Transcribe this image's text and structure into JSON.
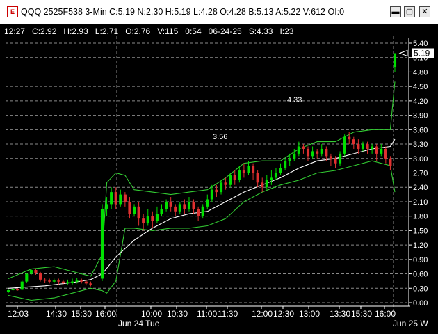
{
  "window": {
    "title": "QQQ 2525F538 3-Min C:5.19 N:2.30 H:5.19 L:4.28 O:4.28 B:5.13 A:5.22 V:612 OI:0",
    "app_icon": "E",
    "min_label": "▬",
    "max_label": "▢",
    "close_label": "✕"
  },
  "infobar": {
    "time": "12:27",
    "close": "C:2.92",
    "high": "H:2.93",
    "low": "L:2.71",
    "open": "O:2.76",
    "volume": "V:115",
    "elapsed": "0:54",
    "date": "06-24-25",
    "s": "S:4.33",
    "i": "I:23"
  },
  "chart_data": {
    "type": "candlestick",
    "y_axis_ticks": [
      "5.40",
      "5.10",
      "4.80",
      "4.50",
      "4.20",
      "3.90",
      "3.60",
      "3.30",
      "3.00",
      "2.70",
      "2.40",
      "2.10",
      "1.80",
      "1.50",
      "1.20",
      "0.90",
      "0.60",
      "0.30",
      "0.00"
    ],
    "ylim": [
      0,
      5.4
    ],
    "x_axis_ticks": [
      "12:03",
      "14:30",
      "15:30",
      "16:00",
      "10:00",
      "10:30",
      "11:00",
      "11:30",
      "12:00",
      "12:30",
      "13:00",
      "13:30",
      "15:30",
      "16:00"
    ],
    "x_date_labels": [
      "Jun 24 Tue",
      "Jun 25 W"
    ],
    "last_price": "5.19",
    "annotations": [
      "3.56",
      "4.33"
    ],
    "colors": {
      "up": "#00e000",
      "down": "#e03030",
      "band": "#33cc33",
      "ma": "#ffffff",
      "grid": "#8a8a8a"
    },
    "candles": [
      [
        0.22,
        0.26,
        0.2,
        0.28
      ],
      [
        0.26,
        0.29,
        0.24,
        0.31
      ],
      [
        0.28,
        0.27,
        0.25,
        0.3
      ],
      [
        0.27,
        0.44,
        0.26,
        0.46
      ],
      [
        0.44,
        0.6,
        0.42,
        0.62
      ],
      [
        0.6,
        0.68,
        0.58,
        0.7
      ],
      [
        0.68,
        0.62,
        0.58,
        0.7
      ],
      [
        0.62,
        0.48,
        0.44,
        0.64
      ],
      [
        0.48,
        0.46,
        0.42,
        0.52
      ],
      [
        0.46,
        0.44,
        0.4,
        0.5
      ],
      [
        0.44,
        0.46,
        0.4,
        0.5
      ],
      [
        0.46,
        0.44,
        0.38,
        0.5
      ],
      [
        0.44,
        0.42,
        0.38,
        0.48
      ],
      [
        0.42,
        0.43,
        0.38,
        0.48
      ],
      [
        0.43,
        0.44,
        0.38,
        0.5
      ],
      [
        0.44,
        0.46,
        0.4,
        0.52
      ],
      [
        0.46,
        0.44,
        0.4,
        0.5
      ],
      [
        0.44,
        0.4,
        0.36,
        0.48
      ],
      [
        0.4,
        0.38,
        0.34,
        0.44
      ],
      [
        0.5,
        1.95,
        0.45,
        2.05
      ],
      [
        1.95,
        2.05,
        1.8,
        2.2
      ],
      [
        2.05,
        2.3,
        1.95,
        2.4
      ],
      [
        2.3,
        2.05,
        1.95,
        2.4
      ],
      [
        2.05,
        2.25,
        2.0,
        2.35
      ],
      [
        2.25,
        2.1,
        2.0,
        2.3
      ],
      [
        2.1,
        1.85,
        1.75,
        2.2
      ],
      [
        1.85,
        2.0,
        1.8,
        2.05
      ],
      [
        2.0,
        1.75,
        1.6,
        2.1
      ],
      [
        1.75,
        1.65,
        1.5,
        1.85
      ],
      [
        1.65,
        1.8,
        1.6,
        1.95
      ],
      [
        1.8,
        1.7,
        1.55,
        1.9
      ],
      [
        1.7,
        1.85,
        1.65,
        2.0
      ],
      [
        1.85,
        1.95,
        1.8,
        2.05
      ],
      [
        1.95,
        2.1,
        1.9,
        2.15
      ],
      [
        2.1,
        2.0,
        1.9,
        2.2
      ],
      [
        2.0,
        1.9,
        1.8,
        2.05
      ],
      [
        1.9,
        2.05,
        1.85,
        2.1
      ],
      [
        2.05,
        1.95,
        1.85,
        2.15
      ],
      [
        1.95,
        2.1,
        1.9,
        2.2
      ],
      [
        2.1,
        1.95,
        1.85,
        2.15
      ],
      [
        1.95,
        1.8,
        1.7,
        2.0
      ],
      [
        1.8,
        2.0,
        1.75,
        2.05
      ],
      [
        2.0,
        2.15,
        1.95,
        2.25
      ],
      [
        2.15,
        2.35,
        2.1,
        2.45
      ],
      [
        2.35,
        2.3,
        2.2,
        2.45
      ],
      [
        2.3,
        2.5,
        2.25,
        2.55
      ],
      [
        2.5,
        2.45,
        2.35,
        2.6
      ],
      [
        2.45,
        2.65,
        2.4,
        2.7
      ],
      [
        2.65,
        2.55,
        2.45,
        2.75
      ],
      [
        2.55,
        2.75,
        2.5,
        2.85
      ],
      [
        2.75,
        2.7,
        2.6,
        2.9
      ],
      [
        2.7,
        2.85,
        2.65,
        2.95
      ],
      [
        2.85,
        2.7,
        2.55,
        2.9
      ],
      [
        2.7,
        2.5,
        2.4,
        2.75
      ],
      [
        2.5,
        2.4,
        2.3,
        2.6
      ],
      [
        2.4,
        2.55,
        2.35,
        2.65
      ],
      [
        2.55,
        2.6,
        2.45,
        2.75
      ],
      [
        2.6,
        2.7,
        2.55,
        2.8
      ],
      [
        2.7,
        2.8,
        2.65,
        2.9
      ],
      [
        2.8,
        2.95,
        2.75,
        3.0
      ],
      [
        2.95,
        3.0,
        2.85,
        3.1
      ],
      [
        3.0,
        3.1,
        2.95,
        3.2
      ],
      [
        3.1,
        3.25,
        3.05,
        3.35
      ],
      [
        3.25,
        3.2,
        3.1,
        3.3
      ],
      [
        3.2,
        3.05,
        2.95,
        3.25
      ],
      [
        3.05,
        3.15,
        3.0,
        3.25
      ],
      [
        3.15,
        3.1,
        3.0,
        3.2
      ],
      [
        3.1,
        3.2,
        3.05,
        3.3
      ],
      [
        3.2,
        3.05,
        2.95,
        3.25
      ],
      [
        3.05,
        3.0,
        2.85,
        3.1
      ],
      [
        3.0,
        2.9,
        2.8,
        3.05
      ],
      [
        2.9,
        3.1,
        2.85,
        3.15
      ],
      [
        3.1,
        3.45,
        3.05,
        3.5
      ],
      [
        3.45,
        3.4,
        3.3,
        3.55
      ],
      [
        3.4,
        3.3,
        3.2,
        3.45
      ],
      [
        3.3,
        3.2,
        3.1,
        3.4
      ],
      [
        3.2,
        3.3,
        3.15,
        3.35
      ],
      [
        3.3,
        3.2,
        3.1,
        3.35
      ],
      [
        3.2,
        3.25,
        3.1,
        3.3
      ],
      [
        3.25,
        3.1,
        2.95,
        3.3
      ],
      [
        3.1,
        3.2,
        3.05,
        3.3
      ],
      [
        3.2,
        3.0,
        2.9,
        3.25
      ],
      [
        3.0,
        2.85,
        2.75,
        3.05
      ],
      [
        4.9,
        5.19,
        4.8,
        5.19
      ]
    ],
    "ma": [
      [
        0,
        0.3
      ],
      [
        8,
        0.35
      ],
      [
        14,
        0.42
      ],
      [
        18,
        0.48
      ],
      [
        19,
        0.6
      ],
      [
        22,
        0.95
      ],
      [
        26,
        1.3
      ],
      [
        30,
        1.55
      ],
      [
        34,
        1.75
      ],
      [
        38,
        1.85
      ],
      [
        42,
        1.9
      ],
      [
        46,
        2.1
      ],
      [
        50,
        2.3
      ],
      [
        54,
        2.45
      ],
      [
        58,
        2.6
      ],
      [
        62,
        2.8
      ],
      [
        66,
        2.95
      ],
      [
        70,
        3.0
      ],
      [
        74,
        3.1
      ],
      [
        78,
        3.2
      ],
      [
        82,
        3.25
      ],
      [
        83,
        3.4
      ]
    ],
    "upper_band": [
      [
        0,
        0.5
      ],
      [
        5,
        0.7
      ],
      [
        10,
        0.75
      ],
      [
        14,
        0.65
      ],
      [
        18,
        0.55
      ],
      [
        19,
        1.0
      ],
      [
        20,
        2.5
      ],
      [
        22,
        2.7
      ],
      [
        24,
        2.65
      ],
      [
        26,
        2.35
      ],
      [
        30,
        2.3
      ],
      [
        34,
        2.25
      ],
      [
        38,
        2.3
      ],
      [
        42,
        2.35
      ],
      [
        46,
        2.6
      ],
      [
        50,
        2.9
      ],
      [
        54,
        2.95
      ],
      [
        58,
        2.95
      ],
      [
        62,
        3.2
      ],
      [
        66,
        3.35
      ],
      [
        70,
        3.35
      ],
      [
        74,
        3.55
      ],
      [
        78,
        3.6
      ],
      [
        82,
        3.6
      ],
      [
        83,
        4.6
      ]
    ],
    "lower_band": [
      [
        0,
        0.15
      ],
      [
        5,
        0.05
      ],
      [
        10,
        0.1
      ],
      [
        14,
        0.2
      ],
      [
        18,
        0.3
      ],
      [
        19,
        0.25
      ],
      [
        20,
        0.2
      ],
      [
        22,
        0.45
      ],
      [
        24,
        1.55
      ],
      [
        26,
        1.55
      ],
      [
        30,
        1.5
      ],
      [
        34,
        1.55
      ],
      [
        38,
        1.55
      ],
      [
        42,
        1.6
      ],
      [
        46,
        1.75
      ],
      [
        50,
        2.1
      ],
      [
        54,
        2.3
      ],
      [
        58,
        2.45
      ],
      [
        62,
        2.55
      ],
      [
        66,
        2.7
      ],
      [
        70,
        2.75
      ],
      [
        74,
        2.85
      ],
      [
        78,
        2.95
      ],
      [
        82,
        2.85
      ],
      [
        83,
        2.3
      ]
    ]
  }
}
